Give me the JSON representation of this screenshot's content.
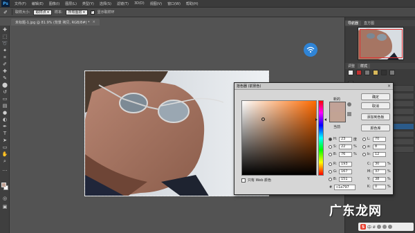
{
  "menubar": {
    "logo": "Ps",
    "items": [
      "文件(F)",
      "编辑(E)",
      "图像(I)",
      "图层(L)",
      "类型(Y)",
      "选择(S)",
      "滤镜(T)",
      "3D(D)",
      "视图(V)",
      "窗口(W)",
      "帮助(H)"
    ]
  },
  "options": {
    "sample_size_label": "取样大小:",
    "sample_size_value": "取样点",
    "sample_label": "样本:",
    "sample_value": "所有图层",
    "show_ring_label": "显示取样环"
  },
  "document": {
    "tab_title": "未标题-1.jpg @ 81.9% (背景 拷贝, RGB/8#) *"
  },
  "right_panel": {
    "tabs": [
      "导航器",
      "直方图"
    ],
    "tabs2": [
      "调整",
      "样式"
    ]
  },
  "color_picker": {
    "title": "拾色器 (前景色)",
    "new_label": "新的",
    "current_label": "当前",
    "buttons": {
      "ok": "确定",
      "cancel": "取消",
      "add_swatch": "添加到色板",
      "libraries": "颜色库"
    },
    "web_only_label": "只有 Web 颜色",
    "fields_left": [
      {
        "key": "H",
        "value": "23",
        "unit": "度",
        "selected": true
      },
      {
        "key": "S",
        "value": "22",
        "unit": "%",
        "selected": false
      },
      {
        "key": "B",
        "value": "76",
        "unit": "%",
        "selected": false
      },
      {
        "key": "R",
        "value": "193",
        "unit": "",
        "selected": false
      },
      {
        "key": "G",
        "value": "167",
        "unit": "",
        "selected": false
      },
      {
        "key": "B",
        "value": "151",
        "unit": "",
        "selected": false
      }
    ],
    "fields_right": [
      {
        "key": "L",
        "value": "70",
        "unit": ""
      },
      {
        "key": "a",
        "value": "8",
        "unit": ""
      },
      {
        "key": "b",
        "value": "12",
        "unit": ""
      },
      {
        "key": "C",
        "value": "30",
        "unit": "%"
      },
      {
        "key": "M",
        "value": "37",
        "unit": "%"
      },
      {
        "key": "Y",
        "value": "38",
        "unit": "%"
      },
      {
        "key": "K",
        "value": "0",
        "unit": "%"
      }
    ],
    "hex_label": "#",
    "hex_value": "c1a797",
    "new_color": "#c1a297",
    "current_color": "#c2a394"
  },
  "watermark": "广东龙网",
  "sogou": {
    "label": "中",
    "extra": "ø"
  }
}
